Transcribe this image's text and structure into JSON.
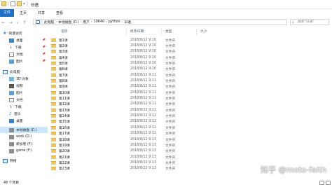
{
  "window": {
    "title": "日语"
  },
  "menu": {
    "file": "文件",
    "home": "主页",
    "share": "共享",
    "view": "查看"
  },
  "address": {
    "crumbs": [
      "此电脑",
      "本地磁盘 (C:)",
      "用户",
      "10640",
      "python",
      "日语"
    ]
  },
  "search": {
    "placeholder": "搜索\"日语\""
  },
  "sidebar": {
    "items": [
      {
        "label": "快速访问",
        "icon": "star-icon",
        "pinned": false
      },
      {
        "label": "桌面",
        "icon": "desktop-icon",
        "pinned": true
      },
      {
        "label": "下载",
        "icon": "download-icon",
        "pinned": true
      },
      {
        "label": "文档",
        "icon": "document-icon",
        "pinned": true
      },
      {
        "label": "图片",
        "icon": "picture-icon",
        "pinned": true
      },
      {
        "label": "此电脑",
        "icon": "computer-icon",
        "pinned": false
      },
      {
        "label": "3D 对象",
        "icon": "cube-icon",
        "pinned": false
      },
      {
        "label": "视频",
        "icon": "video-icon",
        "pinned": false
      },
      {
        "label": "图片",
        "icon": "picture-icon",
        "pinned": false
      },
      {
        "label": "文档",
        "icon": "document-icon",
        "pinned": false
      },
      {
        "label": "下载",
        "icon": "download-icon",
        "pinned": false
      },
      {
        "label": "音乐",
        "icon": "music-icon",
        "pinned": false
      },
      {
        "label": "桌面",
        "icon": "desktop-icon",
        "pinned": false
      },
      {
        "label": "本地磁盘 (C:)",
        "icon": "drive-icon",
        "pinned": false
      },
      {
        "label": "work (D:)",
        "icon": "drive-icon",
        "pinned": false
      },
      {
        "label": "新加卷 (F:)",
        "icon": "drive-icon",
        "pinned": false
      },
      {
        "label": "game (F:)",
        "icon": "drive-icon",
        "pinned": false
      },
      {
        "label": "网络",
        "icon": "network-icon",
        "pinned": false
      }
    ]
  },
  "columns": {
    "name": "名称",
    "date": "修改日期",
    "type": "类型",
    "size": "大小"
  },
  "files": [
    {
      "name": "第1课",
      "date": "2018/8/12 9:10",
      "type": "文件夹"
    },
    {
      "name": "第2课",
      "date": "2018/8/12 9:10",
      "type": "文件夹"
    },
    {
      "name": "第3课",
      "date": "2018/8/12 9:10",
      "type": "文件夹"
    },
    {
      "name": "第4课",
      "date": "2018/8/12 9:10",
      "type": "文件夹"
    },
    {
      "name": "第5课",
      "date": "2018/8/12 9:10",
      "type": "文件夹"
    },
    {
      "name": "第6课",
      "date": "2018/8/12 9:10",
      "type": "文件夹"
    },
    {
      "name": "第7课",
      "date": "2018/8/12 9:11",
      "type": "文件夹"
    },
    {
      "name": "第8课",
      "date": "2018/8/12 9:11",
      "type": "文件夹"
    },
    {
      "name": "第9课",
      "date": "2018/8/12 9:11",
      "type": "文件夹"
    },
    {
      "name": "第10课",
      "date": "2018/8/12 9:11",
      "type": "文件夹"
    },
    {
      "name": "第11课",
      "date": "2018/8/12 9:11",
      "type": "文件夹"
    },
    {
      "name": "第12课",
      "date": "2018/8/12 9:11",
      "type": "文件夹"
    },
    {
      "name": "第13课",
      "date": "2018/8/12 9:11",
      "type": "文件夹"
    },
    {
      "name": "第14课",
      "date": "2018/8/12 9:12",
      "type": "文件夹"
    },
    {
      "name": "第15课",
      "date": "2018/8/12 9:12",
      "type": "文件夹"
    },
    {
      "name": "第16课",
      "date": "2018/8/12 9:12",
      "type": "文件夹"
    },
    {
      "name": "第17课",
      "date": "2018/8/12 9:12",
      "type": "文件夹"
    },
    {
      "name": "第18课",
      "date": "2018/8/12 9:13",
      "type": "文件夹"
    },
    {
      "name": "第19课",
      "date": "2018/8/12 9:13",
      "type": "文件夹"
    },
    {
      "name": "第20课",
      "date": "2018/8/12 9:13",
      "type": "文件夹"
    },
    {
      "name": "第21课",
      "date": "2018/8/12 9:13",
      "type": "文件夹"
    },
    {
      "name": "第22课",
      "date": "2018/8/12 9:13",
      "type": "文件夹"
    },
    {
      "name": "第23课",
      "date": "2018/8/12 9:13",
      "type": "文件夹"
    }
  ],
  "status": {
    "count": "48 个项目"
  },
  "watermark": "知乎 @moto-faith",
  "colors": {
    "accent": "#1f6fc4",
    "selection": "#cce8ff",
    "folder": "#f1c75b"
  }
}
